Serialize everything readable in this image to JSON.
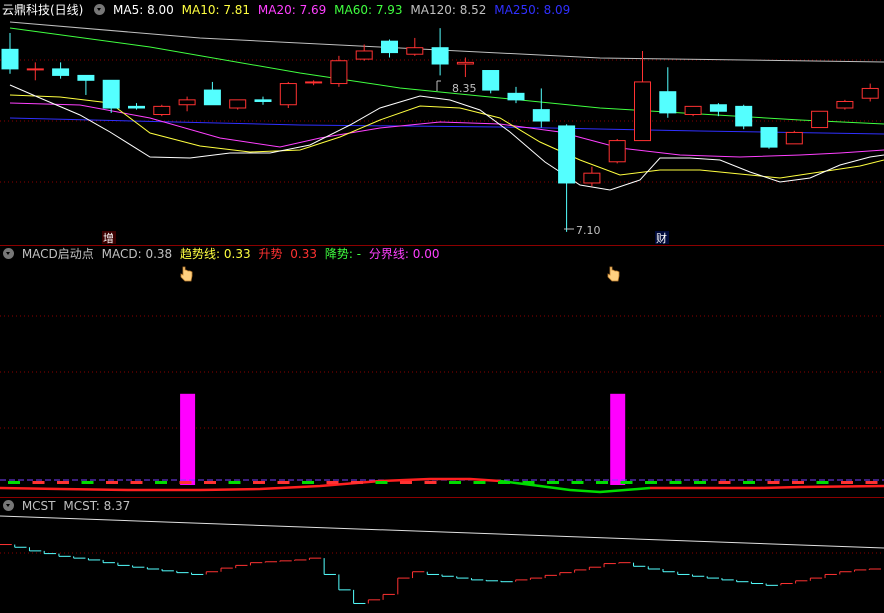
{
  "main_panel": {
    "title": "云鼎科技(日线)",
    "ma": [
      {
        "label": "MA5: 8.00",
        "color": "#ffffff"
      },
      {
        "label": "MA10: 7.81",
        "color": "#ffff40"
      },
      {
        "label": "MA20: 7.69",
        "color": "#ff40ff"
      },
      {
        "label": "MA60: 7.93",
        "color": "#40ff40"
      },
      {
        "label": "MA120: 8.52",
        "color": "#c0c0c0"
      },
      {
        "label": "MA250: 8.09",
        "color": "#3030ff"
      }
    ],
    "high_label": "8.35",
    "low_label": "7.10",
    "marker_zeng": "增",
    "marker_cai": "财"
  },
  "macd_panel": {
    "name": "MACD启动点",
    "macd": "MACD: 0.38",
    "trend_label": "趋势线:",
    "trend_value": "0.33",
    "up_label": "升势",
    "up_value": "0.33",
    "down_label": "降势:",
    "down_value": "-",
    "divider_label": "分界线:",
    "divider_value": "0.00"
  },
  "mcst_panel": {
    "name": "MCST",
    "value": "MCST: 8.37"
  },
  "colors": {
    "up": "#ff3232",
    "down": "#54ffff",
    "grid": "#8c0000",
    "magenta": "#ff00ff",
    "green": "#00dc00"
  },
  "candles": [
    {
      "o": 8.22,
      "h": 8.32,
      "l": 8.07,
      "c": 8.1
    },
    {
      "o": 8.1,
      "h": 8.14,
      "l": 8.03,
      "c": 8.1
    },
    {
      "o": 8.1,
      "h": 8.14,
      "l": 8.04,
      "c": 8.06
    },
    {
      "o": 8.06,
      "h": 8.05,
      "l": 7.94,
      "c": 8.03
    },
    {
      "o": 8.03,
      "h": 8.03,
      "l": 7.83,
      "c": 7.86
    },
    {
      "o": 7.87,
      "h": 7.89,
      "l": 7.85,
      "c": 7.86
    },
    {
      "o": 7.82,
      "h": 7.88,
      "l": 7.81,
      "c": 7.87
    },
    {
      "o": 7.88,
      "h": 7.93,
      "l": 7.84,
      "c": 7.91
    },
    {
      "o": 7.97,
      "h": 8.02,
      "l": 7.88,
      "c": 7.88
    },
    {
      "o": 7.86,
      "h": 7.91,
      "l": 7.85,
      "c": 7.91
    },
    {
      "o": 7.91,
      "h": 7.93,
      "l": 7.88,
      "c": 7.9
    },
    {
      "o": 7.88,
      "h": 8.02,
      "l": 7.86,
      "c": 8.01
    },
    {
      "o": 8.02,
      "h": 8.03,
      "l": 8.0,
      "c": 8.02
    },
    {
      "o": 8.01,
      "h": 8.18,
      "l": 7.99,
      "c": 8.15
    },
    {
      "o": 8.16,
      "h": 8.25,
      "l": 8.15,
      "c": 8.21
    },
    {
      "o": 8.27,
      "h": 8.28,
      "l": 8.17,
      "c": 8.2
    },
    {
      "o": 8.19,
      "h": 8.29,
      "l": 8.18,
      "c": 8.23
    },
    {
      "o": 8.23,
      "h": 8.35,
      "l": 8.06,
      "c": 8.13
    },
    {
      "o": 8.13,
      "h": 8.17,
      "l": 8.05,
      "c": 8.14
    },
    {
      "o": 8.09,
      "h": 8.09,
      "l": 7.95,
      "c": 7.97
    },
    {
      "o": 7.95,
      "h": 7.99,
      "l": 7.89,
      "c": 7.91
    },
    {
      "o": 7.85,
      "h": 7.98,
      "l": 7.74,
      "c": 7.78
    },
    {
      "o": 7.75,
      "h": 7.76,
      "l": 7.1,
      "c": 7.4
    },
    {
      "o": 7.4,
      "h": 7.5,
      "l": 7.38,
      "c": 7.46
    },
    {
      "o": 7.53,
      "h": 7.67,
      "l": 7.52,
      "c": 7.66
    },
    {
      "o": 7.66,
      "h": 8.21,
      "l": 7.66,
      "c": 8.02
    },
    {
      "o": 7.96,
      "h": 8.11,
      "l": 7.8,
      "c": 7.83
    },
    {
      "o": 7.82,
      "h": 7.87,
      "l": 7.81,
      "c": 7.87
    },
    {
      "o": 7.88,
      "h": 7.89,
      "l": 7.81,
      "c": 7.84
    },
    {
      "o": 7.87,
      "h": 7.88,
      "l": 7.73,
      "c": 7.75
    },
    {
      "o": 7.74,
      "h": 7.74,
      "l": 7.61,
      "c": 7.62
    },
    {
      "o": 7.64,
      "h": 7.72,
      "l": 7.64,
      "c": 7.71
    },
    {
      "o": 7.74,
      "h": 7.84,
      "l": 7.74,
      "c": 7.84
    },
    {
      "o": 7.86,
      "h": 7.91,
      "l": 7.85,
      "c": 7.9
    },
    {
      "o": 7.92,
      "h": 8.01,
      "l": 7.9,
      "c": 7.98
    },
    {
      "o": 7.96,
      "h": 7.99,
      "l": 7.85,
      "c": 7.92
    }
  ],
  "macd_bars": [
    0.0,
    0.0,
    0.0,
    0.0,
    0.0,
    0.0,
    0.0,
    0.38,
    0.0,
    0.0,
    0.0,
    0.0,
    0.0,
    0.0,
    0.0,
    0.0,
    0.0,
    0.0,
    0.0,
    0.0,
    0.0,
    0.0,
    0.0,
    0.0,
    0.38,
    0.0,
    0.0,
    0.0,
    0.0,
    0.0,
    0.0,
    0.0,
    0.0,
    0.0,
    0.0,
    0.0
  ],
  "mcst_steps": [
    8.25,
    8.22,
    8.18,
    8.15,
    8.12,
    8.1,
    8.08,
    8.05,
    8.02,
    8.0,
    7.98,
    7.96,
    7.94,
    7.92,
    7.95,
    7.99,
    8.02,
    8.05,
    8.06,
    8.07,
    8.08,
    8.1,
    7.92,
    7.75,
    7.6,
    7.64,
    7.7,
    7.88,
    7.95,
    7.92,
    7.9,
    7.88,
    7.86,
    7.85,
    7.84,
    7.86,
    7.88,
    7.91,
    7.94,
    7.97,
    8.0,
    8.04,
    8.05,
    8.01,
    7.98,
    7.95,
    7.92,
    7.9,
    7.88,
    7.86,
    7.84,
    7.82,
    7.8,
    7.82,
    7.85,
    7.88,
    7.92,
    7.95,
    7.97,
    7.98
  ]
}
